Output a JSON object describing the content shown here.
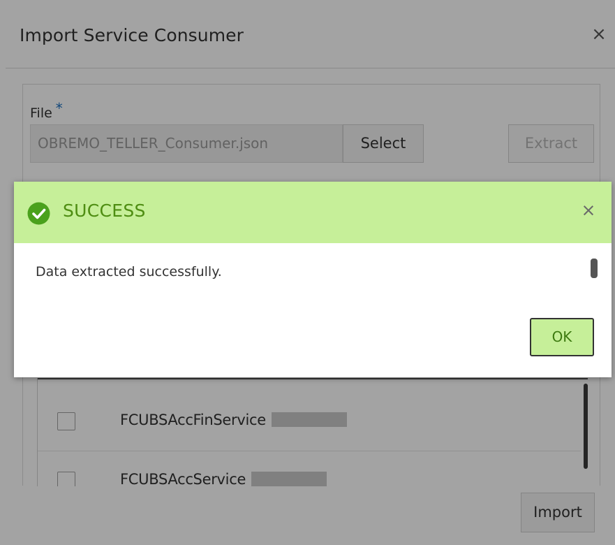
{
  "dialog": {
    "title": "Import Service Consumer",
    "close_symbol": "×",
    "file_label": "File",
    "required_mark": "*",
    "file_value": "OBREMO_TELLER_Consumer.json",
    "select_label": "Select",
    "extract_label": "Extract",
    "import_label": "Import",
    "rows": [
      {
        "name": "FCUBSAccFinService"
      },
      {
        "name": "FCUBSAccService"
      }
    ]
  },
  "popup": {
    "title": "SUCCESS",
    "close_symbol": "×",
    "message": "Data extracted successfully.",
    "ok_label": "OK"
  },
  "icons": {
    "success": "check-circle-icon",
    "close": "close-icon"
  },
  "colors": {
    "success_bg": "#c6ef99",
    "success_text": "#4e8d12",
    "check_circle": "#4aa11c"
  }
}
